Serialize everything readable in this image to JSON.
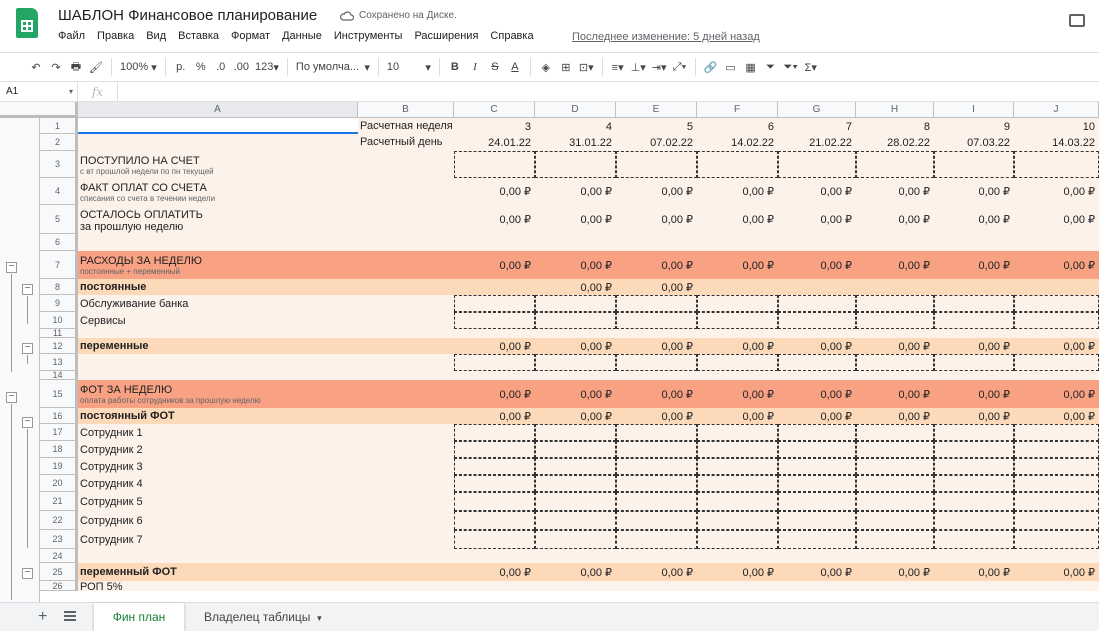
{
  "header": {
    "title": "ШАБЛОН Финансовое планирование",
    "save_status": "Сохранено на Диске.",
    "last_edit": "Последнее изменение: 5 дней назад"
  },
  "menu": [
    "Файл",
    "Правка",
    "Вид",
    "Вставка",
    "Формат",
    "Данные",
    "Инструменты",
    "Расширения",
    "Справка"
  ],
  "toolbar": {
    "zoom": "100%",
    "currency": "р.",
    "percent": "%",
    "dec_minus": ".0",
    "dec_plus": ".00",
    "format": "123",
    "font": "По умолча...",
    "size": "10"
  },
  "formula": {
    "cell": "A1",
    "fx": "fx"
  },
  "columns": [
    "A",
    "B",
    "C",
    "D",
    "E",
    "F",
    "G",
    "H",
    "I",
    "J"
  ],
  "rows": [
    {
      "n": "1",
      "label": "",
      "b": "Расчетная неделя",
      "vals": [
        "3",
        "4",
        "5",
        "6",
        "7",
        "8",
        "9",
        "10"
      ]
    },
    {
      "n": "2",
      "label": "",
      "b": "Расчетный день",
      "vals": [
        "24.01.22",
        "31.01.22",
        "07.02.22",
        "14.02.22",
        "21.02.22",
        "28.02.22",
        "07.03.22",
        "14.03.22"
      ]
    },
    {
      "n": "3",
      "label": "ПОСТУПИЛО НА СЧЕТ",
      "sub": "с вт прошлой недели по пн текущей",
      "vals": [
        "",
        "",
        "",
        "",
        "",
        "",
        "",
        ""
      ]
    },
    {
      "n": "4",
      "label": "ФАКТ ОПЛАТ СО СЧЕТА",
      "sub": "списания со счета в течении недели",
      "vals": [
        "0,00 ₽",
        "0,00 ₽",
        "0,00 ₽",
        "0,00 ₽",
        "0,00 ₽",
        "0,00 ₽",
        "0,00 ₽",
        "0,00 ₽"
      ]
    },
    {
      "n": "5",
      "label": "ОСТАЛОСЬ ОПЛАТИТЬ",
      "sub2": "за прошлую неделю",
      "vals": [
        "0,00 ₽",
        "0,00 ₽",
        "0,00 ₽",
        "0,00 ₽",
        "0,00 ₽",
        "0,00 ₽",
        "0,00 ₽",
        "0,00 ₽"
      ]
    },
    {
      "n": "6",
      "label": "",
      "vals": [
        "",
        "",
        "",
        "",
        "",
        "",
        "",
        ""
      ]
    },
    {
      "n": "7",
      "label": "РАСХОДЫ ЗА НЕДЕЛЮ",
      "sub": "постоянные + переменный",
      "vals": [
        "0,00 ₽",
        "0,00 ₽",
        "0,00 ₽",
        "0,00 ₽",
        "0,00 ₽",
        "0,00 ₽",
        "0,00 ₽",
        "0,00 ₽"
      ]
    },
    {
      "n": "8",
      "label": "постоянные",
      "vals": [
        "",
        "0,00 ₽",
        "0,00 ₽",
        "",
        "",
        "",
        "",
        ""
      ]
    },
    {
      "n": "9",
      "label": "Обслуживание банка",
      "vals": [
        "",
        "",
        "",
        "",
        "",
        "",
        "",
        ""
      ]
    },
    {
      "n": "10",
      "label": "Сервисы",
      "vals": [
        "",
        "",
        "",
        "",
        "",
        "",
        "",
        ""
      ]
    },
    {
      "n": "11",
      "label": "",
      "vals": [
        "",
        "",
        "",
        "",
        "",
        "",
        "",
        ""
      ]
    },
    {
      "n": "12",
      "label": "переменные",
      "vals": [
        "0,00 ₽",
        "0,00 ₽",
        "0,00 ₽",
        "0,00 ₽",
        "0,00 ₽",
        "0,00 ₽",
        "0,00 ₽",
        "0,00 ₽"
      ]
    },
    {
      "n": "13",
      "label": "",
      "vals": [
        "",
        "",
        "",
        "",
        "",
        "",
        "",
        ""
      ]
    },
    {
      "n": "14",
      "label": "",
      "vals": [
        "",
        "",
        "",
        "",
        "",
        "",
        "",
        ""
      ]
    },
    {
      "n": "15",
      "label": "ФОТ ЗА НЕДЕЛЮ",
      "sub": "оплата работы сотрудников за прошлую неделю",
      "vals": [
        "0,00 ₽",
        "0,00 ₽",
        "0,00 ₽",
        "0,00 ₽",
        "0,00 ₽",
        "0,00 ₽",
        "0,00 ₽",
        "0,00 ₽"
      ]
    },
    {
      "n": "16",
      "label": "постоянный ФОТ",
      "vals": [
        "0,00 ₽",
        "0,00 ₽",
        "0,00 ₽",
        "0,00 ₽",
        "0,00 ₽",
        "0,00 ₽",
        "0,00 ₽",
        "0,00 ₽"
      ]
    },
    {
      "n": "17",
      "label": "Сотрудник 1",
      "vals": [
        "",
        "",
        "",
        "",
        "",
        "",
        "",
        ""
      ]
    },
    {
      "n": "18",
      "label": "Сотрудник 2",
      "vals": [
        "",
        "",
        "",
        "",
        "",
        "",
        "",
        ""
      ]
    },
    {
      "n": "19",
      "label": "Сотрудник 3",
      "vals": [
        "",
        "",
        "",
        "",
        "",
        "",
        "",
        ""
      ]
    },
    {
      "n": "20",
      "label": "Сотрудник 4",
      "vals": [
        "",
        "",
        "",
        "",
        "",
        "",
        "",
        ""
      ]
    },
    {
      "n": "21",
      "label": "Сотрудник 5",
      "vals": [
        "",
        "",
        "",
        "",
        "",
        "",
        "",
        ""
      ]
    },
    {
      "n": "22",
      "label": "Сотрудник 6",
      "vals": [
        "",
        "",
        "",
        "",
        "",
        "",
        "",
        ""
      ]
    },
    {
      "n": "23",
      "label": "Сотрудник 7",
      "vals": [
        "",
        "",
        "",
        "",
        "",
        "",
        "",
        ""
      ]
    },
    {
      "n": "24",
      "label": "",
      "vals": [
        "",
        "",
        "",
        "",
        "",
        "",
        "",
        ""
      ]
    },
    {
      "n": "25",
      "label": "переменный ФОТ",
      "vals": [
        "0,00 ₽",
        "0,00 ₽",
        "0,00 ₽",
        "0,00 ₽",
        "0,00 ₽",
        "0,00 ₽",
        "0,00 ₽",
        "0,00 ₽"
      ]
    },
    {
      "n": "26",
      "label": "РОП 5%",
      "vals": [
        "",
        "",
        "",
        "",
        "",
        "",
        "",
        ""
      ]
    }
  ],
  "tabs": [
    "Фин план",
    "Владелец таблицы"
  ],
  "colors": {
    "bg": "#fdf2e9",
    "salmon": "#f8a283",
    "peach": "#fcd9b8",
    "green": "#23a566"
  }
}
